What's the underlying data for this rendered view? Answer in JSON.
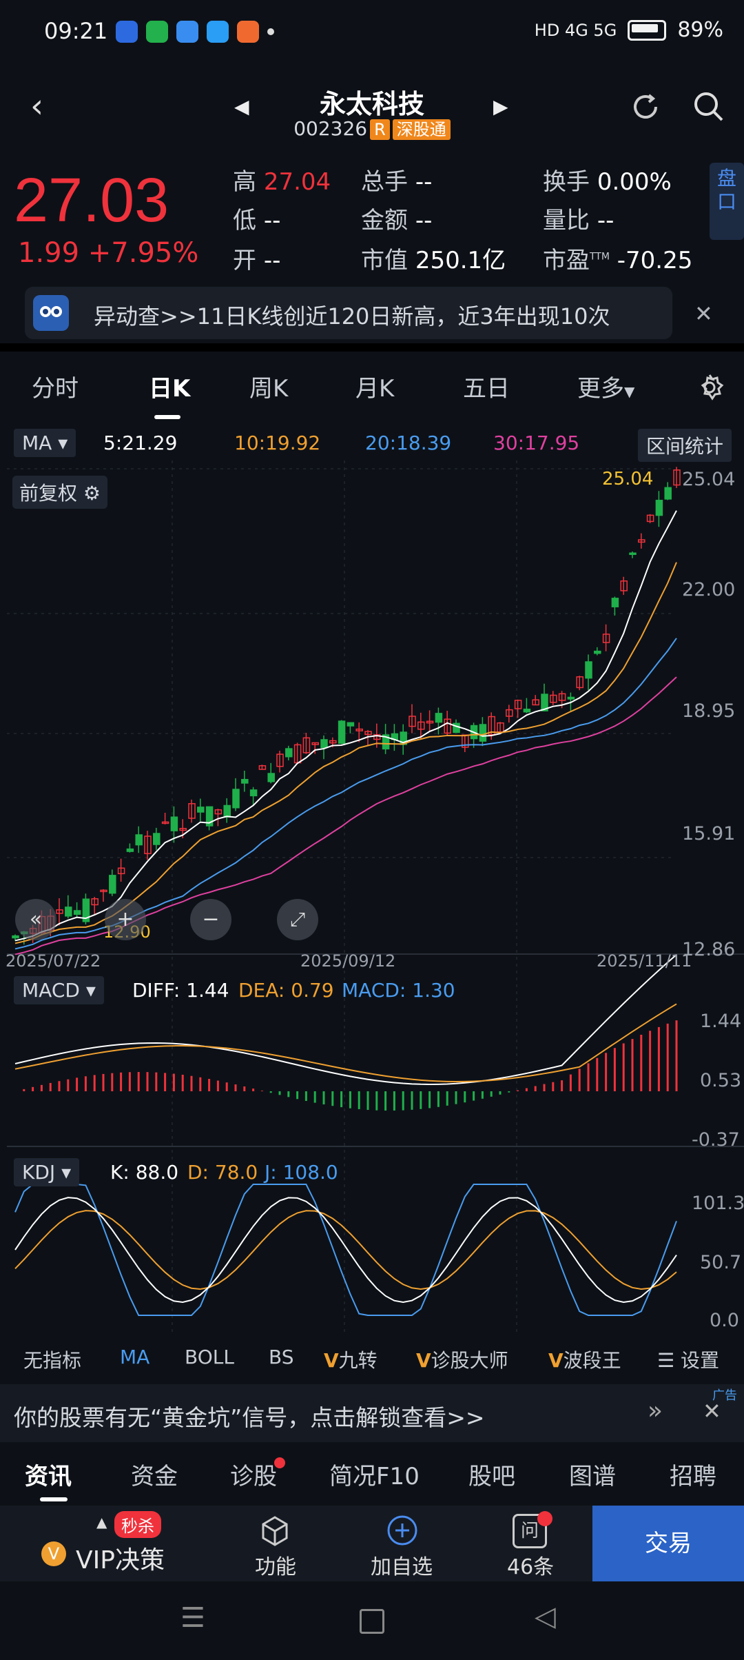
{
  "status": {
    "time": "09:21",
    "signal": "HD 4G 5G",
    "battery": "89%"
  },
  "header": {
    "title": "永太科技",
    "code": "002326",
    "tag_r": "R",
    "tag_market": "深股通"
  },
  "quote": {
    "price": "27.03",
    "change": "1.99",
    "pct": "+7.95%",
    "high_label": "高",
    "high": "27.04",
    "low_label": "低",
    "low": "--",
    "open_label": "开",
    "open": "--",
    "vol_label": "总手",
    "vol": "--",
    "amt_label": "金额",
    "amt": "--",
    "mcap_label": "市值",
    "mcap": "250.1亿",
    "turn_label": "换手",
    "turn": "0.00%",
    "vr_label": "量比",
    "vr": "--",
    "pe_label": "市盈",
    "pe_sup": "TTM",
    "pe": "-70.25",
    "pankou": "盘口"
  },
  "alert": {
    "text": "异动查>>11日K线创近120日新高，近3年出现10次"
  },
  "tabs": [
    "分时",
    "日K",
    "周K",
    "月K",
    "五日",
    "更多"
  ],
  "ma": {
    "label": "MA",
    "ma5": "5:21.29",
    "ma10": "10:19.92",
    "ma20": "20:18.39",
    "ma30": "30:17.95",
    "range_btn": "区间统计"
  },
  "chart_labels": {
    "qfq": "前复权",
    "high_mark": "25.04",
    "low_mark": "12.90",
    "d1": "2025/07/22",
    "d2": "2025/09/12",
    "d3": "2025/11/11"
  },
  "price_axis": [
    "25.04",
    "22.00",
    "18.95",
    "15.91",
    "12.86"
  ],
  "macd": {
    "label": "MACD",
    "diff": "DIFF: 1.44",
    "dea": "DEA: 0.79",
    "macd": "MACD: 1.30",
    "axis": [
      "1.44",
      "0.53",
      "-0.37"
    ]
  },
  "kdj": {
    "label": "KDJ",
    "k": "K: 88.0",
    "d": "D: 78.0",
    "j": "J: 108.0",
    "axis": [
      "101.3",
      "50.7",
      "0.0"
    ]
  },
  "indicators": [
    "无指标",
    "MA",
    "BOLL",
    "BS",
    "九转",
    "诊股大师",
    "波段王",
    "设置"
  ],
  "ad": {
    "text": "你的股票有无“黄金坑”信号，点击解锁查看>>",
    "tag": "广告"
  },
  "nav_tabs": [
    "资讯",
    "资金",
    "诊股",
    "简况F10",
    "股吧",
    "图谱",
    "招聘"
  ],
  "footer": {
    "vip": "VIP决策",
    "flash": "秒杀",
    "func": "功能",
    "add": "加自选",
    "ask": "46条",
    "ask_icon": "问",
    "trade": "交易"
  },
  "colors": {
    "up": "#f0323c",
    "down": "#1fb04b",
    "ma5": "#ffffff",
    "ma10": "#f0a030",
    "ma20": "#4a9cf0",
    "ma30": "#e040a0"
  }
}
